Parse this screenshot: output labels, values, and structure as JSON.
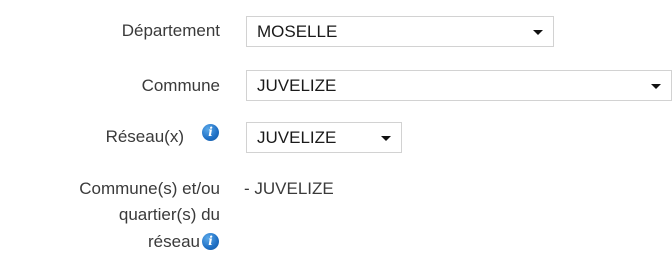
{
  "form": {
    "departement": {
      "label": "Département",
      "value": "MOSELLE"
    },
    "commune": {
      "label": "Commune",
      "value": "JUVELIZE"
    },
    "reseau": {
      "label": "Réseau(x)",
      "value": "JUVELIZE",
      "info_icon": "info-icon"
    },
    "communes_reseau": {
      "label_line1": "Commune(s) et/ou",
      "label_line2": "quartier(s) du",
      "label_line3": "réseau",
      "value": "- JUVELIZE",
      "info_icon": "info-icon"
    }
  },
  "colors": {
    "info_icon": "#1f6fc4",
    "select_border": "#d2d2d2"
  }
}
